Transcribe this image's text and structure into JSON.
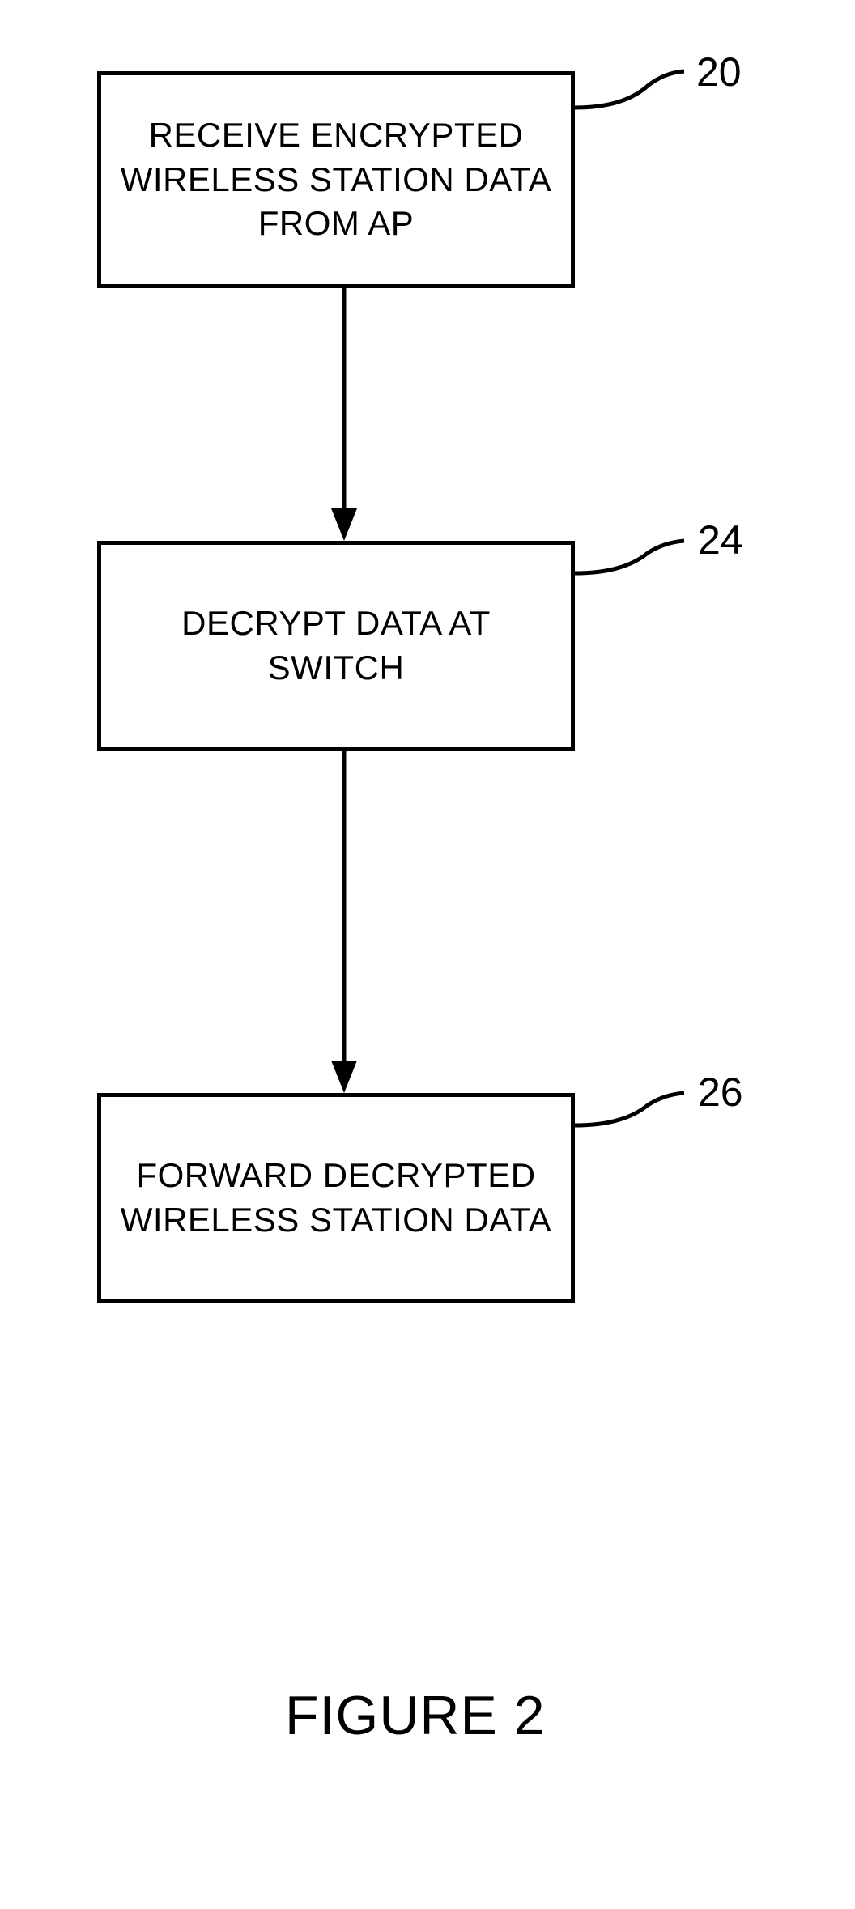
{
  "boxes": {
    "step1": "RECEIVE ENCRYPTED WIRELESS STATION DATA FROM AP",
    "step2": "DECRYPT DATA AT SWITCH",
    "step3": "FORWARD DECRYPTED WIRELESS STATION DATA"
  },
  "labels": {
    "l20": "20",
    "l24": "24",
    "l26": "26"
  },
  "figure": "FIGURE 2"
}
